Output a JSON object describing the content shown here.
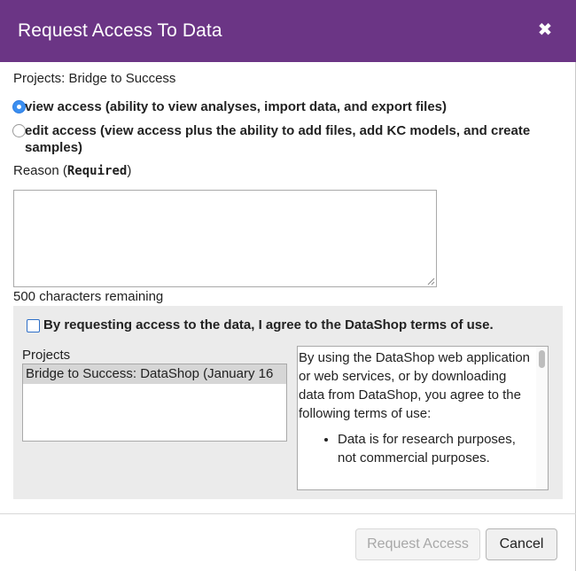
{
  "dialog": {
    "title": "Request Access To Data",
    "close_glyph": "✖"
  },
  "projects_line": "Projects: Bridge to Success",
  "access_options": [
    {
      "label": "view access (ability to view analyses, import data, and export files)",
      "checked": true
    },
    {
      "label": "edit access (view access plus the ability to add files, add KC models, and create samples)",
      "checked": false
    }
  ],
  "reason": {
    "label_prefix": "Reason (",
    "label_required": "Required",
    "label_suffix": ")",
    "value": "",
    "chars_remaining": "500 characters remaining"
  },
  "terms": {
    "checkbox_label": "By requesting access to the data, I agree to the DataShop terms of use.",
    "checked": false,
    "projects_label": "Projects",
    "projects_list": [
      "Bridge to Success: DataShop (January 16"
    ],
    "terms_paragraph": "By using the DataShop web application or web services, or by downloading data from DataShop, you agree to the following terms of use:",
    "terms_bullets": [
      "Data is for research purposes, not commercial purposes."
    ]
  },
  "buttons": {
    "request_access": "Request Access",
    "cancel": "Cancel"
  },
  "colors": {
    "titlebar": "#6b3585",
    "radio_accent": "#3b8ff0",
    "panel_background": "#ebebeb"
  },
  "icons": {
    "close": "close-icon",
    "resize": "resize-grip-icon"
  }
}
